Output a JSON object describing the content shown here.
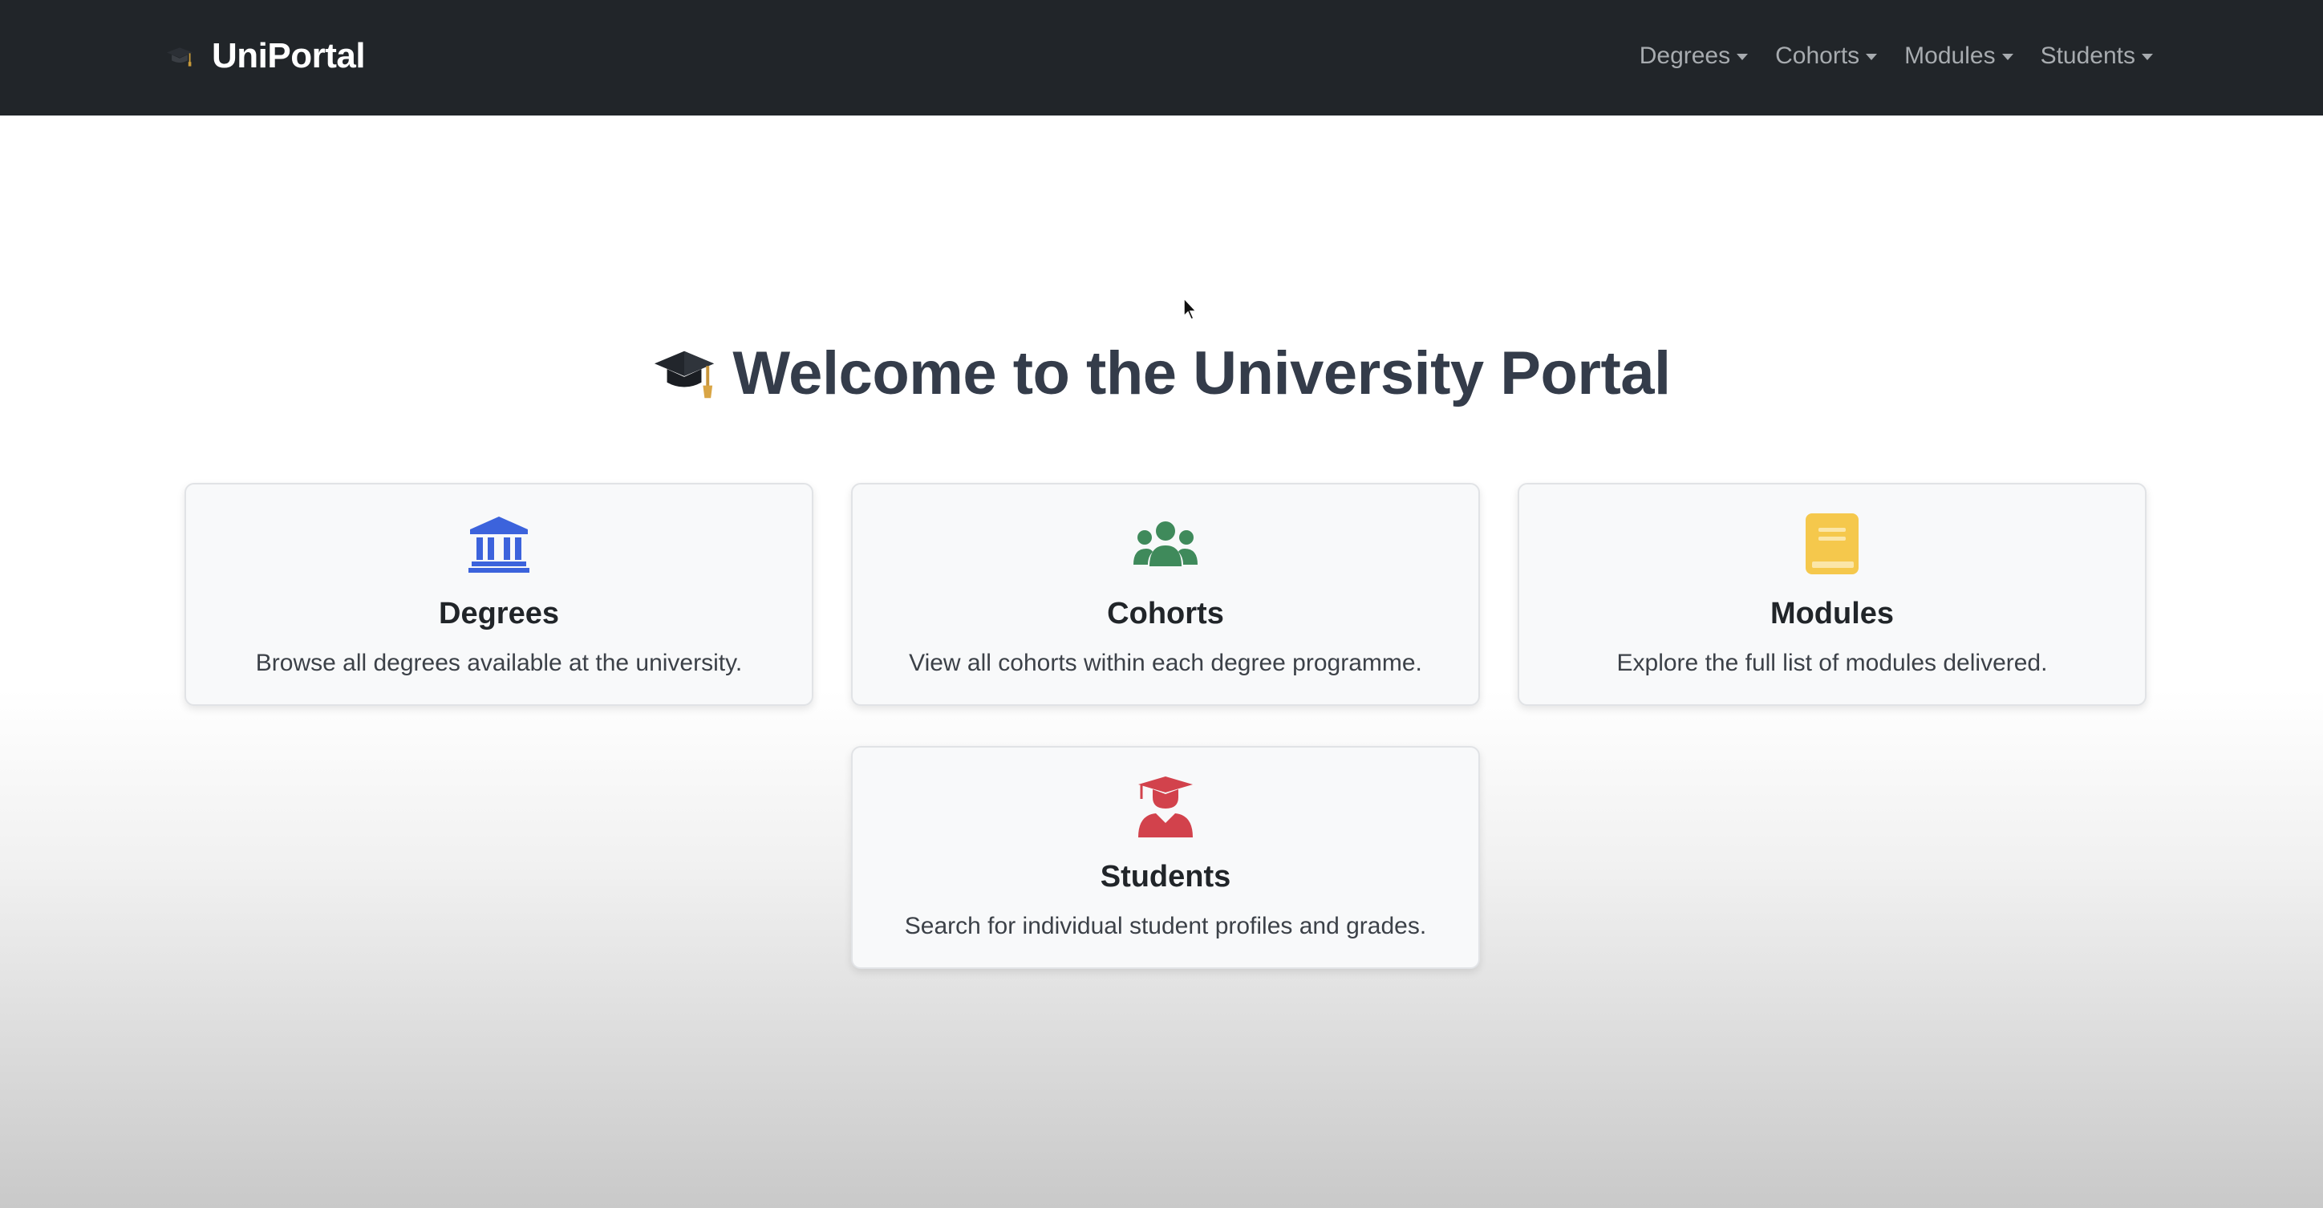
{
  "navbar": {
    "brand_label": "UniPortal",
    "brand_icon": "graduation-cap-icon",
    "items": [
      {
        "label": "Degrees"
      },
      {
        "label": "Cohorts"
      },
      {
        "label": "Modules"
      },
      {
        "label": "Students"
      }
    ],
    "background": "#212529",
    "text_color": "#a7abaf"
  },
  "main": {
    "title": "Welcome to the University Portal",
    "title_icon": "graduation-cap-icon",
    "title_color": "#343c4a",
    "cards": [
      {
        "title": "Degrees",
        "description": "Browse all degrees available at the university.",
        "icon": "university-building-icon",
        "icon_color": "#3c63dc"
      },
      {
        "title": "Cohorts",
        "description": "View all cohorts within each degree programme.",
        "icon": "users-group-icon",
        "icon_color": "#3f8a5b"
      },
      {
        "title": "Modules",
        "description": "Explore the full list of modules delivered.",
        "icon": "book-icon",
        "icon_color": "#f5c84c"
      },
      {
        "title": "Students",
        "description": "Search for individual student profiles and grades.",
        "icon": "student-graduate-icon",
        "icon_color": "#d2424c"
      }
    ]
  }
}
